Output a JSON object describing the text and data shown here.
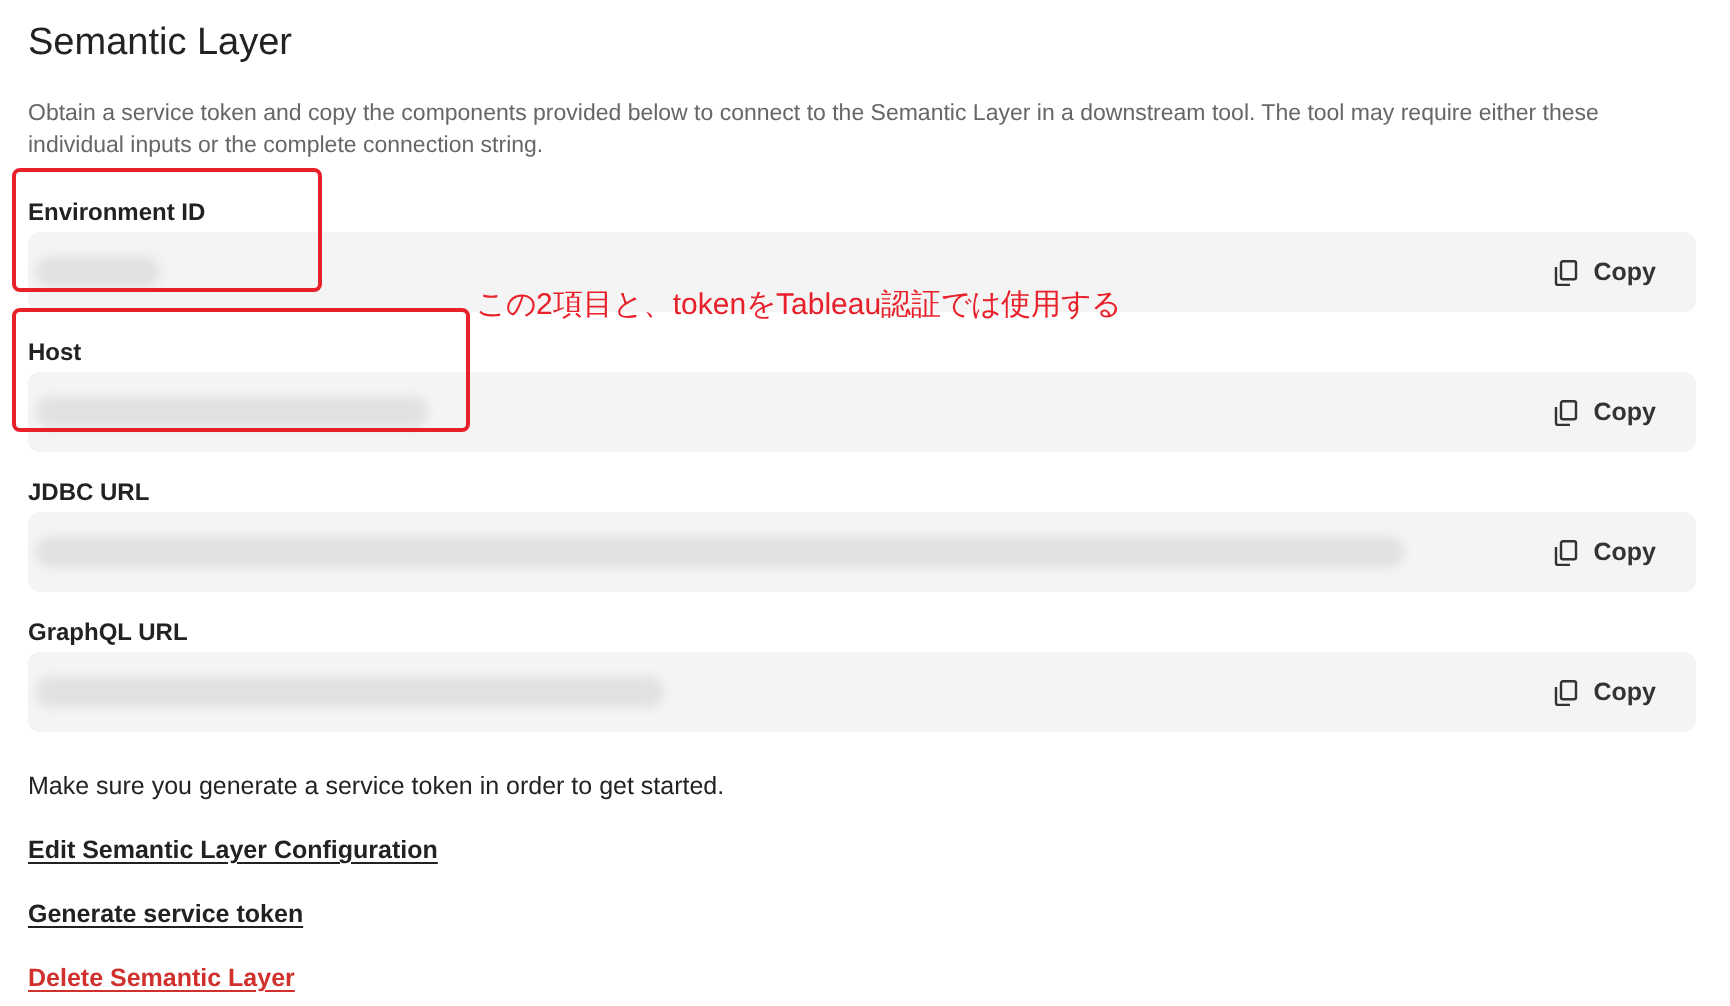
{
  "title": "Semantic Layer",
  "description": "Obtain a service token and copy the components provided below to connect to the Semantic Layer in a downstream tool. The tool may require either these individual inputs or the complete connection string.",
  "fields": [
    {
      "label": "Environment ID",
      "redacted": true,
      "highlighted": true,
      "copy_label": "Copy"
    },
    {
      "label": "Host",
      "redacted": true,
      "highlighted": true,
      "copy_label": "Copy"
    },
    {
      "label": "JDBC URL",
      "redacted": true,
      "highlighted": false,
      "copy_label": "Copy"
    },
    {
      "label": "GraphQL URL",
      "redacted": true,
      "highlighted": false,
      "copy_label": "Copy"
    }
  ],
  "annotation": "この2項目と、tokenをTableau認証では使用する",
  "note": "Make sure you generate a service token in order to get started.",
  "links": [
    {
      "label": "Edit Semantic Layer Configuration",
      "kind": "normal"
    },
    {
      "label": "Generate service token",
      "kind": "normal"
    },
    {
      "label": "Delete Semantic Layer",
      "kind": "danger"
    }
  ]
}
